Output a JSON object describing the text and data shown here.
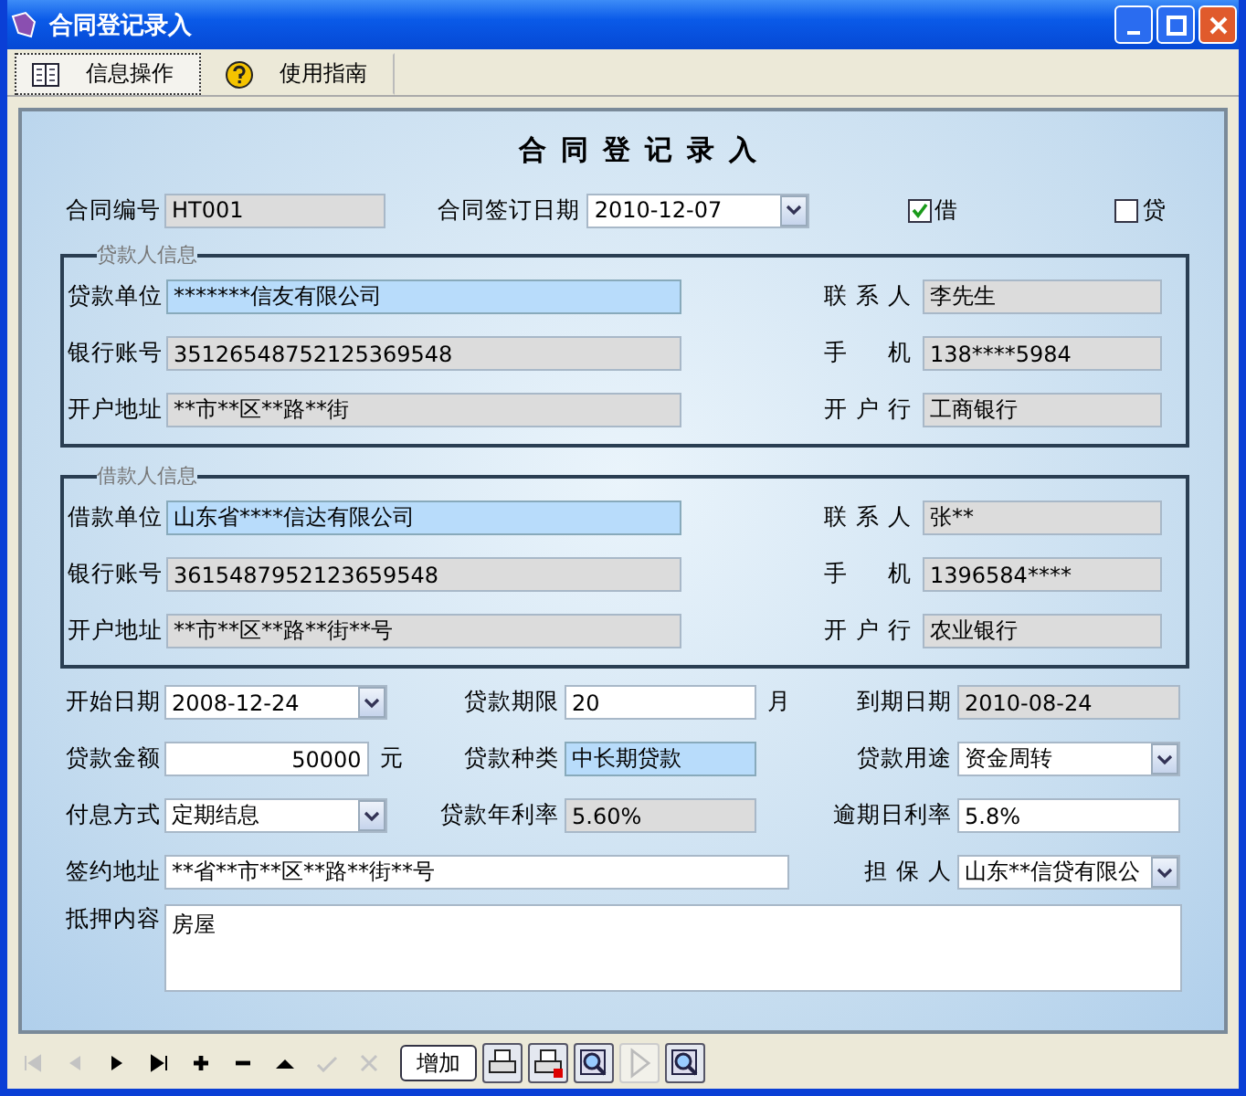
{
  "window": {
    "title": "合同登记录入"
  },
  "tabs": [
    {
      "label": "信息操作",
      "selected": true
    },
    {
      "label": "使用指南",
      "selected": false
    }
  ],
  "form": {
    "heading": "合同登记录入",
    "top": [
      {
        "label": "合同编号",
        "value": "HT001",
        "kind": "readonly"
      },
      {
        "label": "合同签订日期",
        "value": "2010-12-07",
        "kind": "combo"
      }
    ],
    "checks": [
      {
        "label": "借",
        "checked": true
      },
      {
        "label": "贷",
        "checked": false
      }
    ],
    "groups": [
      {
        "title": "贷款人信息",
        "rows": [
          [
            {
              "label": "贷款单位",
              "value": "*******信友有限公司",
              "kind": "focus"
            },
            {
              "label": "联系人",
              "value": "李先生",
              "kind": "readonly"
            }
          ],
          [
            {
              "label": "银行账号",
              "value": "35126548752125369548",
              "kind": "readonly"
            },
            {
              "label": "手机",
              "value": "138****5984",
              "kind": "readonly"
            }
          ],
          [
            {
              "label": "开户地址",
              "value": "**市**区**路**街",
              "kind": "readonly"
            },
            {
              "label": "开户行",
              "value": "工商银行",
              "kind": "readonly"
            }
          ]
        ]
      },
      {
        "title": "借款人信息",
        "rows": [
          [
            {
              "label": "借款单位",
              "value": "山东省****信达有限公司",
              "kind": "focus"
            },
            {
              "label": "联系人",
              "value": "张**",
              "kind": "readonly"
            }
          ],
          [
            {
              "label": "银行账号",
              "value": "3615487952123659548",
              "kind": "readonly"
            },
            {
              "label": "手机",
              "value": "1396584****",
              "kind": "readonly"
            }
          ],
          [
            {
              "label": "开户地址",
              "value": "**市**区**路**街**号",
              "kind": "readonly"
            },
            {
              "label": "开户行",
              "value": "农业银行",
              "kind": "readonly"
            }
          ]
        ]
      }
    ],
    "details": [
      {
        "label": "开始日期",
        "value": "2008-12-24",
        "kind": "combo"
      },
      {
        "label": "贷款期限",
        "value": "20",
        "kind": "input",
        "unit": "月"
      },
      {
        "label": "到期日期",
        "value": "2010-08-24",
        "kind": "readonly"
      },
      {
        "label": "贷款金额",
        "value": "50000",
        "kind": "number",
        "unit": "元"
      },
      {
        "label": "贷款种类",
        "value": "中长期贷款",
        "kind": "focus"
      },
      {
        "label": "贷款用途",
        "value": "资金周转",
        "kind": "combo"
      },
      {
        "label": "付息方式",
        "value": "定期结息",
        "kind": "combo"
      },
      {
        "label": "贷款年利率",
        "value": "5.60%",
        "kind": "readonly"
      },
      {
        "label": "逾期日利率",
        "value": "5.8%",
        "kind": "input"
      },
      {
        "label": "签约地址",
        "value": "**省**市**区**路**街**号",
        "kind": "input"
      },
      {
        "label": "担保人",
        "value": "山东**信贷有限公",
        "kind": "combo"
      }
    ],
    "memo": {
      "label": "抵押内容",
      "value": "房屋"
    }
  },
  "toolbar": [
    {
      "kind": "first",
      "disabled": true
    },
    {
      "kind": "prev",
      "disabled": true
    },
    {
      "kind": "next",
      "disabled": false
    },
    {
      "kind": "last",
      "disabled": false
    },
    {
      "kind": "insert",
      "disabled": false
    },
    {
      "kind": "delete",
      "disabled": false
    },
    {
      "kind": "edit",
      "disabled": false
    },
    {
      "kind": "post",
      "disabled": true
    },
    {
      "kind": "cancel",
      "disabled": true
    },
    {
      "kind": "add",
      "label": "增加",
      "disabled": false
    },
    {
      "kind": "print",
      "disabled": false
    },
    {
      "kind": "print-setup",
      "disabled": false
    },
    {
      "kind": "preview",
      "disabled": false
    },
    {
      "kind": "play",
      "disabled": true
    },
    {
      "kind": "zoom",
      "disabled": false
    }
  ]
}
